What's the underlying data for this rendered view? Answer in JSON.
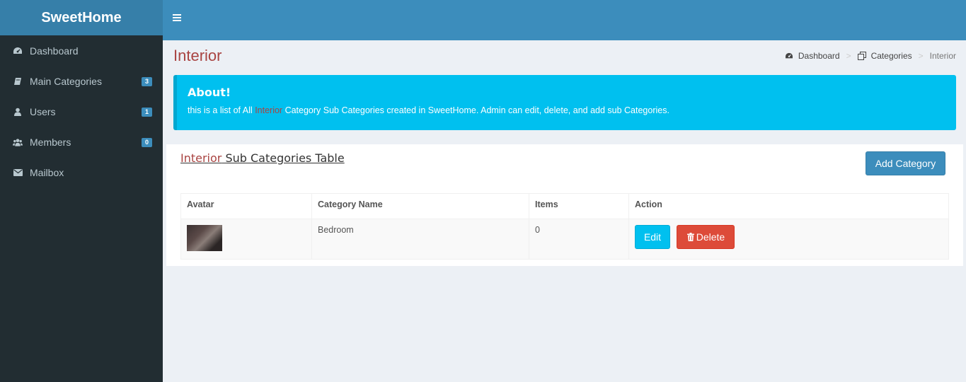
{
  "app": {
    "brand": "SweetHome"
  },
  "sidebar": {
    "items": [
      {
        "label": "Dashboard",
        "icon": "dashboard-icon"
      },
      {
        "label": "Main Categories",
        "icon": "book-icon",
        "badge": "3"
      },
      {
        "label": "Users",
        "icon": "user-icon",
        "badge": "1"
      },
      {
        "label": "Members",
        "icon": "users-icon",
        "badge": "0"
      },
      {
        "label": "Mailbox",
        "icon": "envelope-icon"
      }
    ]
  },
  "page": {
    "title": "Interior"
  },
  "breadcrumb": {
    "items": [
      {
        "label": "Dashboard",
        "icon": "dashboard-icon"
      },
      {
        "label": "Categories",
        "icon": "clone-icon"
      },
      {
        "label": "Interior"
      }
    ]
  },
  "callout": {
    "title": "About!",
    "text_before": "this is a list of All ",
    "highlight": "Interior",
    "text_after": " Category Sub Categories created in SweetHome. Admin can edit, delete, and add sub Categories."
  },
  "box": {
    "title_highlight": "Interior",
    "title_rest": " Sub Categories Table",
    "add_button": "Add Category"
  },
  "table": {
    "headers": [
      "Avatar",
      "Category Name",
      "Items",
      "Action"
    ],
    "rows": [
      {
        "name": "Bedroom",
        "items": "0",
        "edit": "Edit",
        "delete": "Delete"
      }
    ]
  },
  "colors": {
    "primary": "#3c8dbc",
    "info": "#00c0ef",
    "danger": "#dd4b39",
    "sidebar": "#222d32",
    "accent_text": "#a94442"
  }
}
